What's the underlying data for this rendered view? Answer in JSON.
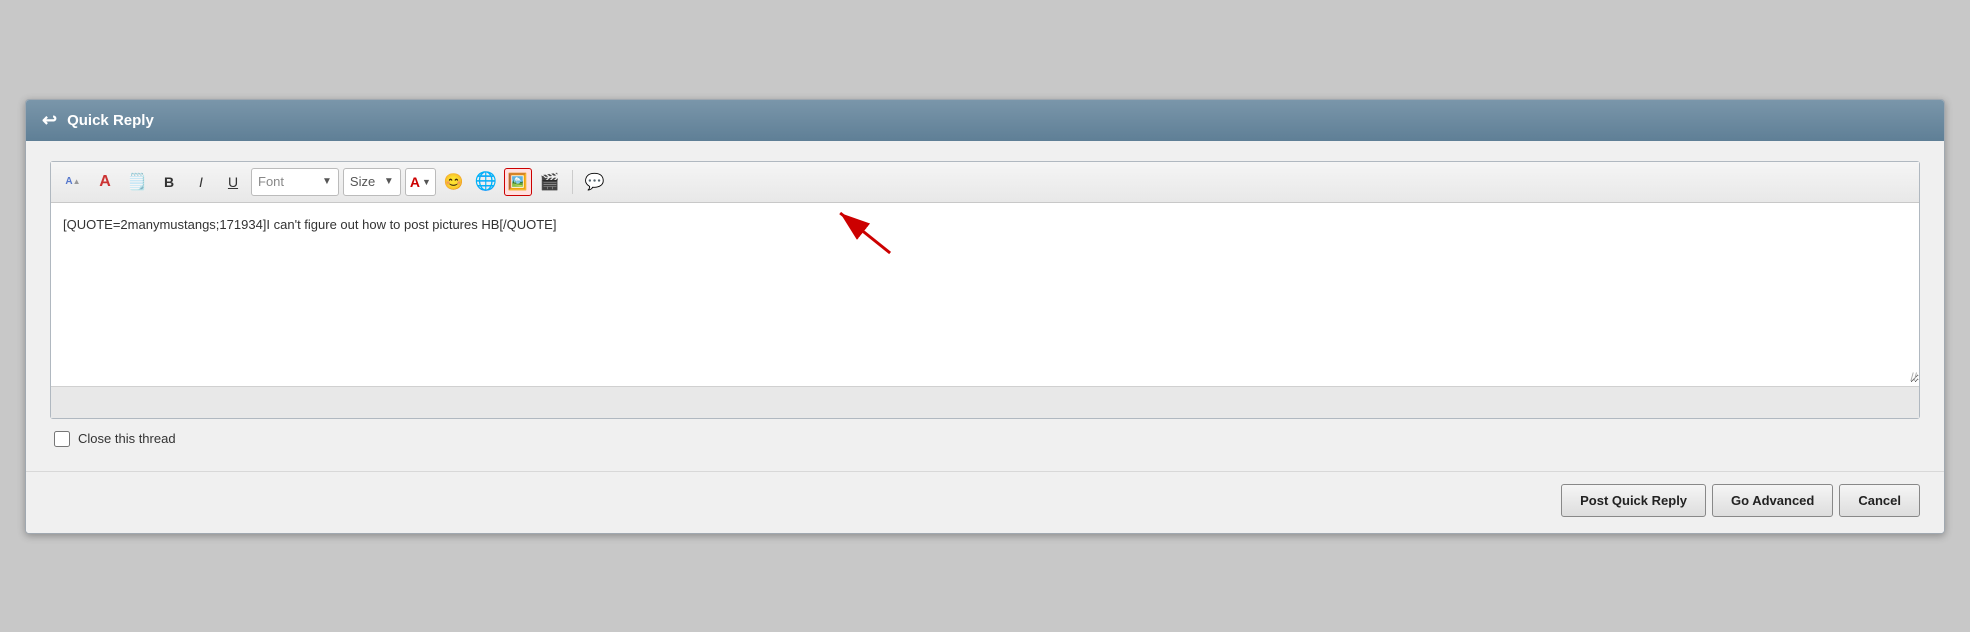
{
  "header": {
    "title": "Quick Reply",
    "back_icon": "↩"
  },
  "toolbar": {
    "font_size_decrease_label": "A",
    "font_size_increase_label": "A",
    "font_placeholder": "Font",
    "size_label": "Size",
    "bold_label": "B",
    "italic_label": "I",
    "underline_label": "U",
    "color_label": "A",
    "emoji_label": "😊"
  },
  "editor": {
    "content": "[QUOTE=2manymustangs;171934]I can't figure out how to post pictures HB[/QUOTE]",
    "placeholder": ""
  },
  "close_thread": {
    "label": "Close this thread"
  },
  "footer": {
    "post_quick_reply": "Post Quick Reply",
    "go_advanced": "Go Advanced",
    "cancel": "Cancel"
  }
}
